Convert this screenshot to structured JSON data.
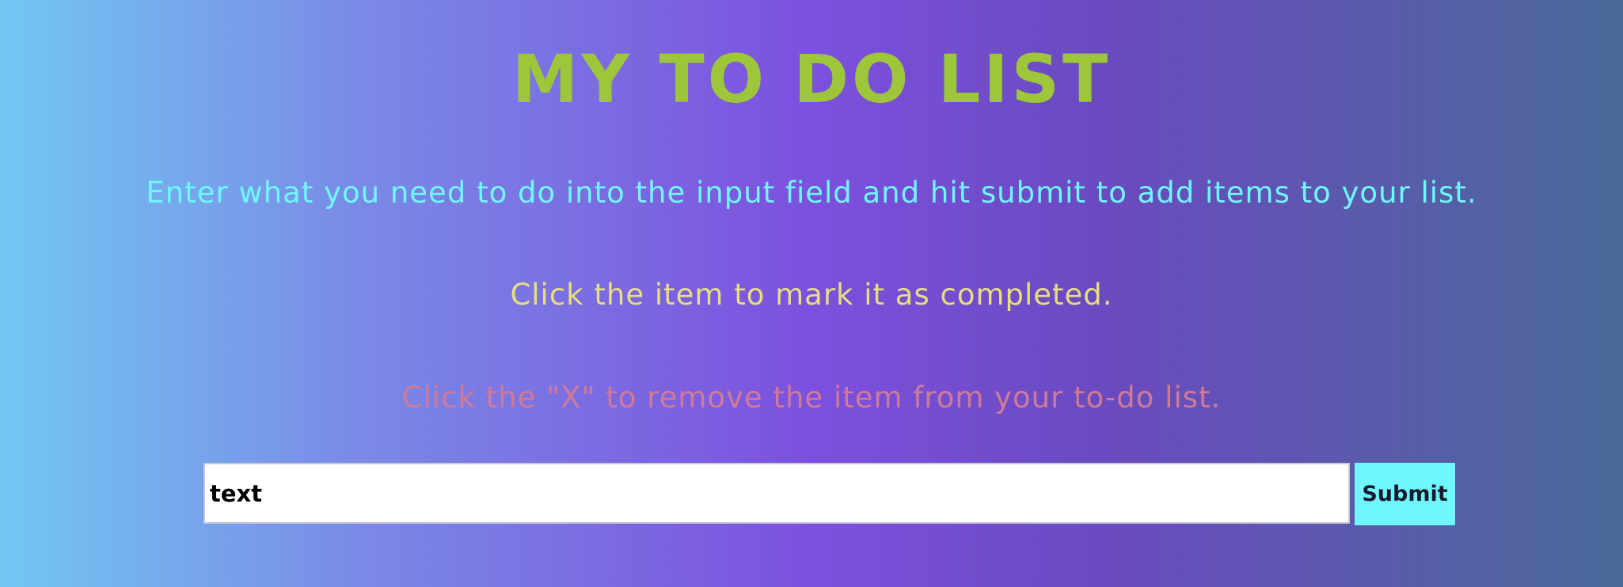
{
  "page": {
    "title": "MY TO DO LIST",
    "instructions": [
      "Enter what you need to do into the input field and hit submit to add items to your list.",
      "Click the item to mark it as completed.",
      "Click the \"X\" to remove the item from your to-do list."
    ]
  },
  "form": {
    "input_value": "text",
    "submit_label": "Submit"
  },
  "colors": {
    "title": "#9dc63b",
    "instruction_1": "#6ff7fd",
    "instruction_2": "#e6df7e",
    "instruction_3": "#d07a98",
    "submit_button": "#6ff7fd",
    "gradient": [
      "#72c7f2",
      "#7c50de",
      "#4a6a98"
    ]
  }
}
